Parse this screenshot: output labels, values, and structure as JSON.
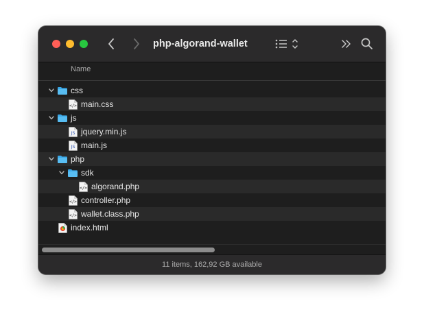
{
  "window": {
    "title": "php-algorand-wallet"
  },
  "toolbar": {
    "back_icon": "chevron-left-icon",
    "forward_icon": "chevron-right-icon",
    "view_icon": "list-view-icon",
    "sort_icon": "up-down-chevron-icon",
    "more_icon": "double-chevron-right-icon",
    "search_icon": "magnifier-icon"
  },
  "header": {
    "name": "Name"
  },
  "rows": [
    {
      "label": "css",
      "kind": "folder",
      "level": 0,
      "expanded": true
    },
    {
      "label": "main.css",
      "kind": "code-file",
      "level": 1
    },
    {
      "label": "js",
      "kind": "folder",
      "level": 0,
      "expanded": true
    },
    {
      "label": "jquery.min.js",
      "kind": "js-file",
      "level": 1
    },
    {
      "label": "main.js",
      "kind": "js-file",
      "level": 1
    },
    {
      "label": "php",
      "kind": "folder",
      "level": 0,
      "expanded": true
    },
    {
      "label": "sdk",
      "kind": "folder",
      "level": 1,
      "expanded": true
    },
    {
      "label": "algorand.php",
      "kind": "code-file",
      "level": 2
    },
    {
      "label": "controller.php",
      "kind": "code-file",
      "level": 1
    },
    {
      "label": "wallet.class.php",
      "kind": "code-file",
      "level": 1
    },
    {
      "label": "index.html",
      "kind": "html-file",
      "level": 0
    }
  ],
  "status": {
    "text": "11 items, 162,92 GB available"
  },
  "colors": {
    "folder": "#3aa8e8",
    "close": "#ff5f57",
    "minimize": "#febc2e",
    "zoom": "#28c840"
  }
}
